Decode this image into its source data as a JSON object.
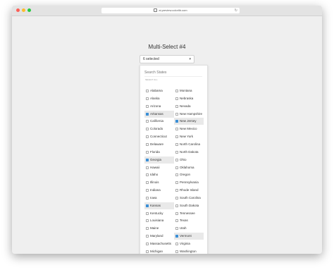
{
  "browser": {
    "url": "ai.preview.colorlib.com"
  },
  "page": {
    "title": "Multi-Select #4"
  },
  "select": {
    "value": "6 selected"
  },
  "dropdown": {
    "search_placeholder": "Search States",
    "select_all_label": "SELECT ALL",
    "left_options": [
      {
        "label": "Alabama",
        "selected": false
      },
      {
        "label": "Alaska",
        "selected": false
      },
      {
        "label": "Arizona",
        "selected": false
      },
      {
        "label": "Arkansas",
        "selected": true
      },
      {
        "label": "California",
        "selected": false
      },
      {
        "label": "Colorado",
        "selected": false
      },
      {
        "label": "Connecticut",
        "selected": false
      },
      {
        "label": "Delaware",
        "selected": false
      },
      {
        "label": "Florida",
        "selected": false
      },
      {
        "label": "Georgia",
        "selected": true
      },
      {
        "label": "Hawaii",
        "selected": false
      },
      {
        "label": "Idaho",
        "selected": false
      },
      {
        "label": "Illinois",
        "selected": false
      },
      {
        "label": "Indiana",
        "selected": false
      },
      {
        "label": "Iowa",
        "selected": false
      },
      {
        "label": "Kansas",
        "selected": true
      },
      {
        "label": "Kentucky",
        "selected": false
      },
      {
        "label": "Louisiana",
        "selected": false
      },
      {
        "label": "Maine",
        "selected": false
      },
      {
        "label": "Maryland",
        "selected": false
      },
      {
        "label": "Massachusetts",
        "selected": false
      },
      {
        "label": "Michigan",
        "selected": false
      },
      {
        "label": "Minnesota",
        "selected": true
      }
    ],
    "right_options": [
      {
        "label": "Montana",
        "selected": false
      },
      {
        "label": "Nebraska",
        "selected": false
      },
      {
        "label": "Nevada",
        "selected": false
      },
      {
        "label": "New Hampshire",
        "selected": false
      },
      {
        "label": "New Jersey",
        "selected": true
      },
      {
        "label": "New Mexico",
        "selected": false
      },
      {
        "label": "New York",
        "selected": false
      },
      {
        "label": "North Carolina",
        "selected": false
      },
      {
        "label": "North Dakota",
        "selected": false
      },
      {
        "label": "Ohio",
        "selected": false
      },
      {
        "label": "Oklahoma",
        "selected": false
      },
      {
        "label": "Oregon",
        "selected": false
      },
      {
        "label": "Pennsylvania",
        "selected": false
      },
      {
        "label": "Rhode Island",
        "selected": false
      },
      {
        "label": "South Carolina",
        "selected": false
      },
      {
        "label": "South Dakota",
        "selected": false
      },
      {
        "label": "Tennessee",
        "selected": false
      },
      {
        "label": "Texas",
        "selected": false
      },
      {
        "label": "Utah",
        "selected": false
      },
      {
        "label": "Vermont",
        "selected": true
      },
      {
        "label": "Virginia",
        "selected": false
      },
      {
        "label": "Washington",
        "selected": false
      },
      {
        "label": "West Virginia",
        "selected": false
      }
    ]
  },
  "colors": {
    "accent": "#3b8fd6",
    "selected_row": "#e9e9e9"
  }
}
